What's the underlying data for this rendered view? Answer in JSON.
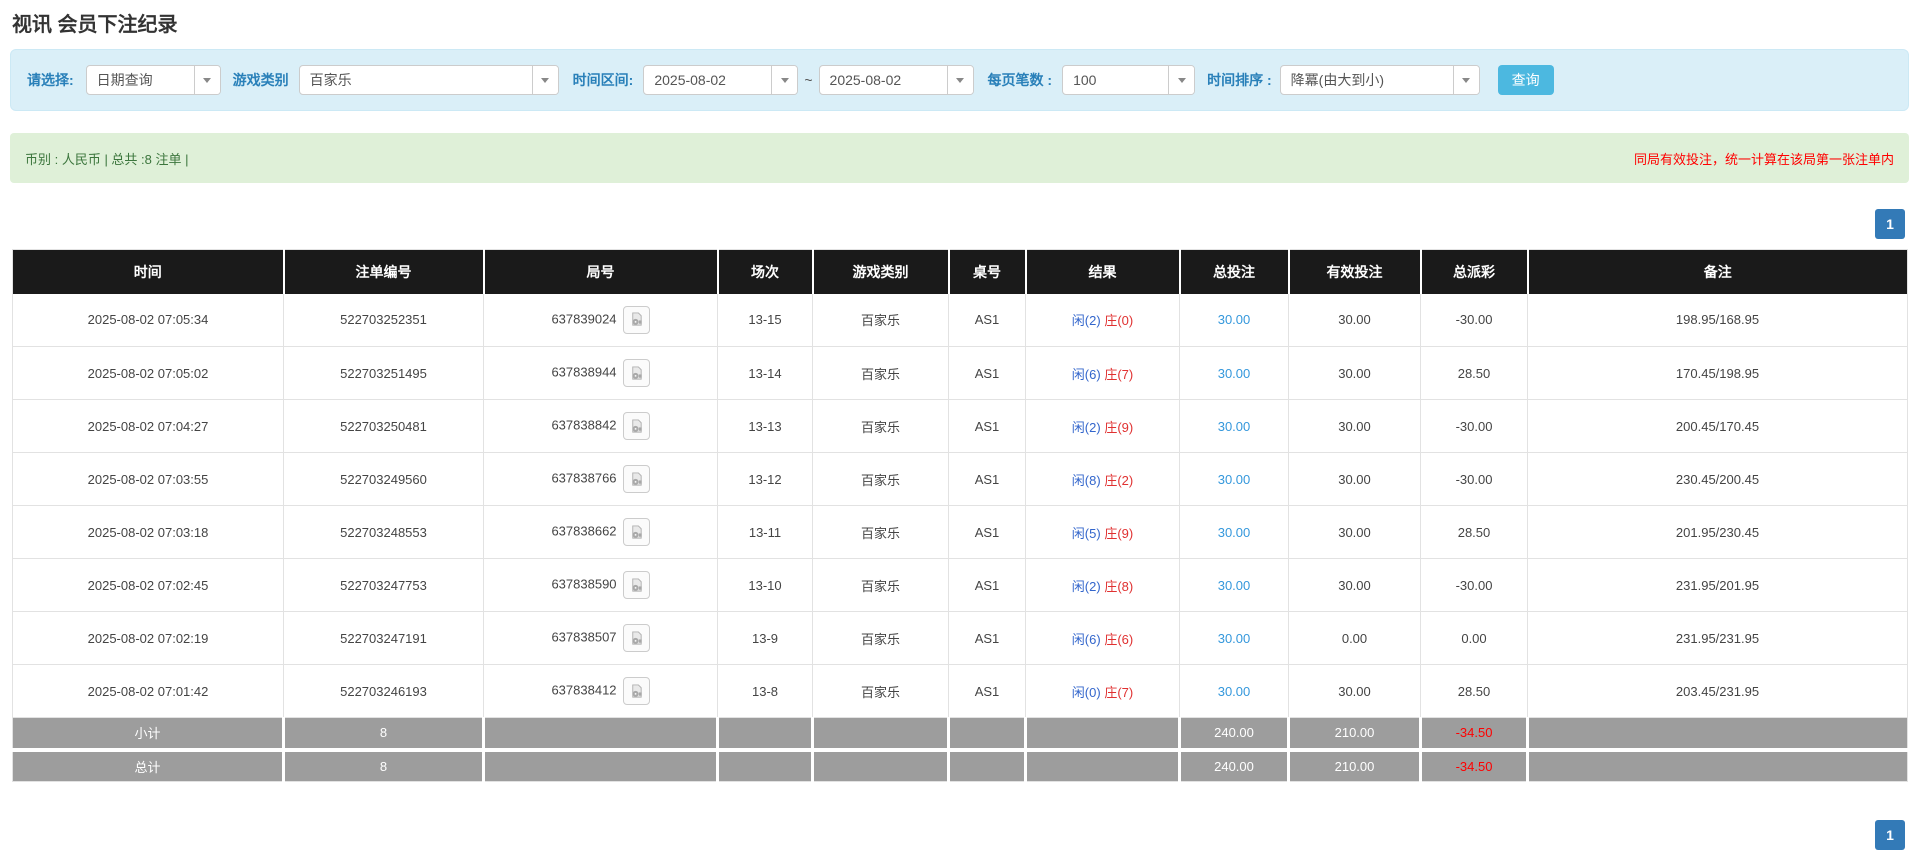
{
  "page": {
    "title": "视讯 会员下注纪录"
  },
  "filters": {
    "select_label": "请选择:",
    "select_value": "日期查询",
    "game_label": "游戏类别",
    "game_value": "百家乐",
    "range_label": "时间区间:",
    "date_from": "2025-08-02",
    "tilde": "~",
    "date_to": "2025-08-02",
    "per_page_label": "每页笔数 :",
    "per_page_value": "100",
    "sort_label": "时间排序 :",
    "sort_value": "降冪(由大到小)",
    "search_button": "查询"
  },
  "summary": {
    "left": "币别 : 人民币 | 总共 :8 注单 |",
    "right": "同局有效投注，统一计算在该局第一张注单内"
  },
  "pagination": {
    "page": "1"
  },
  "table": {
    "headers": [
      "时间",
      "注单编号",
      "局号",
      "场次",
      "游戏类别",
      "桌号",
      "结果",
      "总投注",
      "有效投注",
      "总派彩",
      "备注"
    ],
    "rows": [
      {
        "time": "2025-08-02 07:05:34",
        "bet_id": "522703252351",
        "round_id": "637839024",
        "session": "13-15",
        "game": "百家乐",
        "table_no": "AS1",
        "player": "闲(2)",
        "banker": "庄(0)",
        "total_bet": "30.00",
        "valid_bet": "30.00",
        "payout": "-30.00",
        "remark": "198.95/168.95"
      },
      {
        "time": "2025-08-02 07:05:02",
        "bet_id": "522703251495",
        "round_id": "637838944",
        "session": "13-14",
        "game": "百家乐",
        "table_no": "AS1",
        "player": "闲(6)",
        "banker": "庄(7)",
        "total_bet": "30.00",
        "valid_bet": "30.00",
        "payout": "28.50",
        "remark": "170.45/198.95"
      },
      {
        "time": "2025-08-02 07:04:27",
        "bet_id": "522703250481",
        "round_id": "637838842",
        "session": "13-13",
        "game": "百家乐",
        "table_no": "AS1",
        "player": "闲(2)",
        "banker": "庄(9)",
        "total_bet": "30.00",
        "valid_bet": "30.00",
        "payout": "-30.00",
        "remark": "200.45/170.45"
      },
      {
        "time": "2025-08-02 07:03:55",
        "bet_id": "522703249560",
        "round_id": "637838766",
        "session": "13-12",
        "game": "百家乐",
        "table_no": "AS1",
        "player": "闲(8)",
        "banker": "庄(2)",
        "total_bet": "30.00",
        "valid_bet": "30.00",
        "payout": "-30.00",
        "remark": "230.45/200.45"
      },
      {
        "time": "2025-08-02 07:03:18",
        "bet_id": "522703248553",
        "round_id": "637838662",
        "session": "13-11",
        "game": "百家乐",
        "table_no": "AS1",
        "player": "闲(5)",
        "banker": "庄(9)",
        "total_bet": "30.00",
        "valid_bet": "30.00",
        "payout": "28.50",
        "remark": "201.95/230.45"
      },
      {
        "time": "2025-08-02 07:02:45",
        "bet_id": "522703247753",
        "round_id": "637838590",
        "session": "13-10",
        "game": "百家乐",
        "table_no": "AS1",
        "player": "闲(2)",
        "banker": "庄(8)",
        "total_bet": "30.00",
        "valid_bet": "30.00",
        "payout": "-30.00",
        "remark": "231.95/201.95"
      },
      {
        "time": "2025-08-02 07:02:19",
        "bet_id": "522703247191",
        "round_id": "637838507",
        "session": "13-9",
        "game": "百家乐",
        "table_no": "AS1",
        "player": "闲(6)",
        "banker": "庄(6)",
        "total_bet": "30.00",
        "valid_bet": "0.00",
        "payout": "0.00",
        "remark": "231.95/231.95"
      },
      {
        "time": "2025-08-02 07:01:42",
        "bet_id": "522703246193",
        "round_id": "637838412",
        "session": "13-8",
        "game": "百家乐",
        "table_no": "AS1",
        "player": "闲(0)",
        "banker": "庄(7)",
        "total_bet": "30.00",
        "valid_bet": "30.00",
        "payout": "28.50",
        "remark": "203.45/231.95"
      }
    ],
    "subtotal": {
      "label": "小计",
      "count": "8",
      "total_bet": "240.00",
      "valid_bet": "210.00",
      "payout": "-34.50"
    },
    "grand_total": {
      "label": "总计",
      "count": "8",
      "total_bet": "240.00",
      "valid_bet": "210.00",
      "payout": "-34.50"
    }
  },
  "colors": {
    "button_blue": "#4cb8e0",
    "pagination_blue": "#337ab7",
    "player_blue": "#3366cc",
    "banker_red": "#e03131",
    "negative_red": "#ff0000",
    "summary_green_bg": "#dff0d8",
    "summary_green_text": "#3c763d",
    "header_black": "#1a1a1a",
    "subtotal_grey": "#9d9d9d"
  }
}
